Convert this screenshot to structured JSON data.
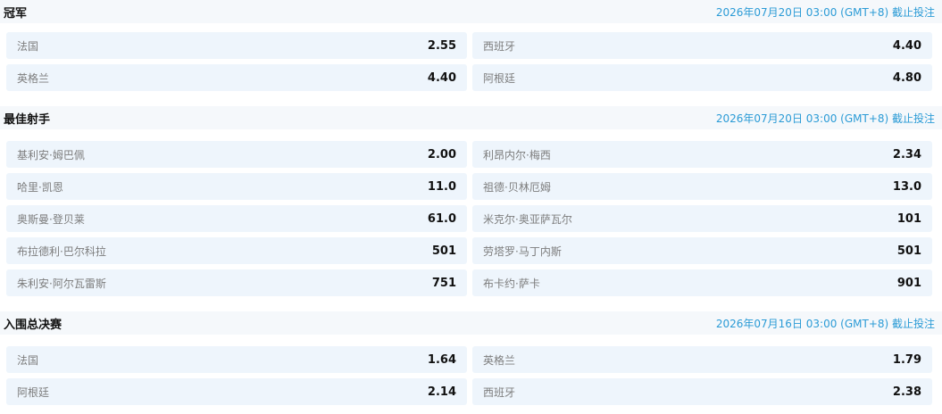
{
  "sections": [
    {
      "title": "冠军",
      "deadline": "2026年07月20日 03:00 (GMT+8) 截止投注",
      "rows": [
        [
          {
            "name": "法国",
            "odds": "2.55"
          },
          {
            "name": "西班牙",
            "odds": "4.40"
          }
        ],
        [
          {
            "name": "英格兰",
            "odds": "4.40"
          },
          {
            "name": "阿根廷",
            "odds": "4.80"
          }
        ]
      ]
    },
    {
      "title": "最佳射手",
      "deadline": "2026年07月20日 03:00 (GMT+8) 截止投注",
      "rows": [
        [
          {
            "name": "基利安·姆巴佩",
            "odds": "2.00"
          },
          {
            "name": "利昂内尔·梅西",
            "odds": "2.34"
          }
        ],
        [
          {
            "name": "哈里·凯恩",
            "odds": "11.0"
          },
          {
            "name": "祖德·贝林厄姆",
            "odds": "13.0"
          }
        ],
        [
          {
            "name": "奥斯曼·登贝莱",
            "odds": "61.0"
          },
          {
            "name": "米克尔·奥亚萨瓦尔",
            "odds": "101"
          }
        ],
        [
          {
            "name": "布拉德利·巴尔科拉",
            "odds": "501"
          },
          {
            "name": "劳塔罗·马丁内斯",
            "odds": "501"
          }
        ],
        [
          {
            "name": "朱利安·阿尔瓦雷斯",
            "odds": "751"
          },
          {
            "name": "布卡约·萨卡",
            "odds": "901"
          }
        ]
      ]
    },
    {
      "title": "入围总决赛",
      "deadline": "2026年07月16日 03:00 (GMT+8) 截止投注",
      "rows": [
        [
          {
            "name": "法国",
            "odds": "1.64"
          },
          {
            "name": "英格兰",
            "odds": "1.79"
          }
        ],
        [
          {
            "name": "阿根廷",
            "odds": "2.14"
          },
          {
            "name": "西班牙",
            "odds": "2.38"
          }
        ]
      ]
    }
  ]
}
